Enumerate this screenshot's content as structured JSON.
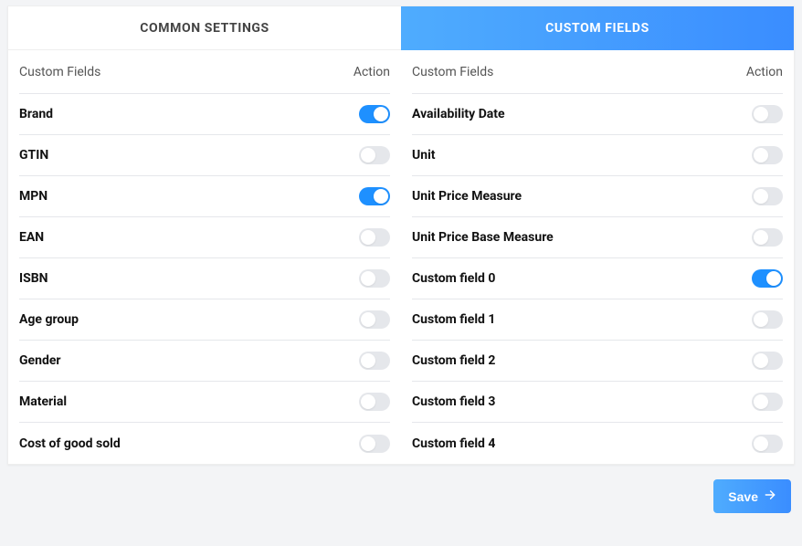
{
  "tabs": {
    "common_settings": "COMMON SETTINGS",
    "custom_fields": "CUSTOM FIELDS",
    "active": "custom_fields"
  },
  "headers": {
    "field": "Custom Fields",
    "action": "Action"
  },
  "left_fields": [
    {
      "label": "Brand",
      "on": true
    },
    {
      "label": "GTIN",
      "on": false
    },
    {
      "label": "MPN",
      "on": true
    },
    {
      "label": "EAN",
      "on": false
    },
    {
      "label": "ISBN",
      "on": false
    },
    {
      "label": "Age group",
      "on": false
    },
    {
      "label": "Gender",
      "on": false
    },
    {
      "label": "Material",
      "on": false
    },
    {
      "label": "Cost of good sold",
      "on": false
    }
  ],
  "right_fields": [
    {
      "label": "Availability Date",
      "on": false
    },
    {
      "label": "Unit",
      "on": false
    },
    {
      "label": "Unit Price Measure",
      "on": false
    },
    {
      "label": "Unit Price Base Measure",
      "on": false
    },
    {
      "label": "Custom field 0",
      "on": true
    },
    {
      "label": "Custom field 1",
      "on": false
    },
    {
      "label": "Custom field 2",
      "on": false
    },
    {
      "label": "Custom field 3",
      "on": false
    },
    {
      "label": "Custom field 4",
      "on": false
    }
  ],
  "buttons": {
    "save": "Save"
  },
  "colors": {
    "accent": "#1e90ff"
  }
}
